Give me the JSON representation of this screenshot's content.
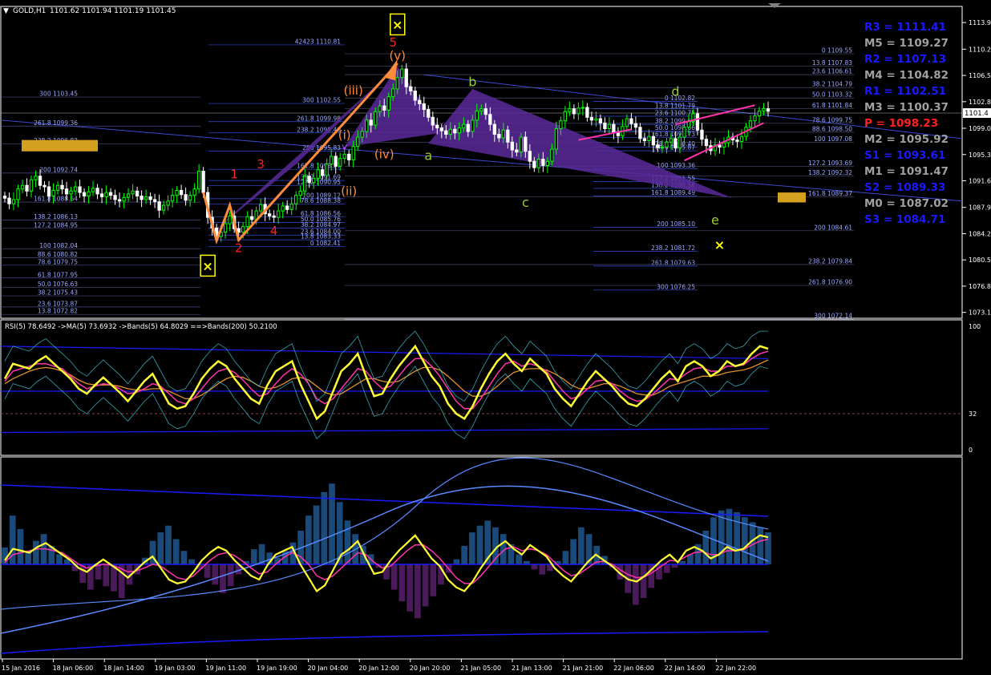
{
  "window": {
    "symbol_label": "GOLD,H1",
    "ohlc": "1101.62 1101.94 1101.19 1101.45",
    "current_price": "1101.45"
  },
  "colors": {
    "bg": "#000000",
    "grid": "#ffffff",
    "bull": "#00ff00",
    "bear": "#ffffff",
    "fib_blue": "#3a5bff",
    "pattern_purple": "#5a2a9a",
    "wave_orange": "#ff8c3a",
    "pivot_blue": "#1a1aff",
    "pivot_gray": "#a0a0a0",
    "pivot_red": "#ff2020",
    "rsi_yellow": "#ffff33",
    "magenta": "#ff33aa",
    "gold_box": "#d4a020"
  },
  "chart_data": [
    {
      "type": "candlestick",
      "panel": "main",
      "price_axis_ticks": [
        "1113.95",
        "1110.20",
        "1106.50",
        "1102.80",
        "1099.05",
        "1095.35",
        "1091.65",
        "1087.90",
        "1084.20",
        "1080.50",
        "1076.80",
        "1073.10"
      ],
      "ylim": [
        1072.5,
        1116.0
      ],
      "price_label": "1101.4",
      "time_labels": [
        "15 Jan 2016",
        "18 Jan 06:00",
        "18 Jan 14:00",
        "19 Jan 03:00",
        "19 Jan 11:00",
        "19 Jan 19:00",
        "20 Jan 04:00",
        "20 Jan 12:00",
        "20 Jan 20:00",
        "21 Jan 05:00",
        "21 Jan 13:00",
        "21 Jan 21:00",
        "22 Jan 06:00",
        "22 Jan 14:00",
        "22 Jan 22:00"
      ],
      "close": [
        1089.2,
        1088.4,
        1089.0,
        1090.5,
        1091.0,
        1090.2,
        1091.8,
        1092.3,
        1091.0,
        1090.8,
        1089.5,
        1090.3,
        1091.0,
        1090.5,
        1089.8,
        1090.2,
        1090.8,
        1090.0,
        1089.5,
        1090.1,
        1090.6,
        1089.8,
        1089.4,
        1090.0,
        1089.6,
        1089.0,
        1088.8,
        1089.3,
        1089.8,
        1090.2,
        1089.5,
        1089.0,
        1089.4,
        1089.0,
        1088.7,
        1087.5,
        1088.2,
        1088.8,
        1089.6,
        1090.3,
        1089.7,
        1088.9,
        1089.6,
        1090.5,
        1093.0,
        1090.0,
        1086.5,
        1085.0,
        1083.8,
        1084.4,
        1085.6,
        1086.7,
        1084.9,
        1084.4,
        1085.2,
        1086.6,
        1086.2,
        1087.4,
        1088.3,
        1087.0,
        1086.7,
        1086.5,
        1087.4,
        1088.1,
        1087.6,
        1088.4,
        1089.6,
        1090.2,
        1092.3,
        1091.4,
        1092.0,
        1093.2,
        1092.4,
        1094.0,
        1095.1,
        1093.7,
        1094.8,
        1095.4,
        1094.6,
        1096.5,
        1097.8,
        1098.6,
        1100.2,
        1099.5,
        1101.4,
        1102.2,
        1101.6,
        1103.5,
        1104.6,
        1106.2,
        1107.4,
        1104.9,
        1104.3,
        1103.0,
        1102.5,
        1101.7,
        1100.6,
        1099.5,
        1099.1,
        1098.7,
        1098.2,
        1098.9,
        1098.4,
        1099.1,
        1099.6,
        1098.6,
        1100.2,
        1101.5,
        1101.8,
        1101.0,
        1099.6,
        1098.2,
        1097.7,
        1098.8,
        1097.1,
        1096.0,
        1095.7,
        1097.8,
        1095.8,
        1094.4,
        1093.5,
        1094.7,
        1093.8,
        1094.4,
        1096.1,
        1099.0,
        1100.1,
        1101.4,
        1101.8,
        1101.1,
        1101.9,
        1102.0,
        1100.6,
        1100.2,
        1100.4,
        1099.8,
        1099.0,
        1099.6,
        1098.4,
        1098.0,
        1099.3,
        1100.4,
        1099.7,
        1099.2,
        1097.6,
        1097.3,
        1097.9,
        1096.7,
        1096.3,
        1096.4,
        1097.1,
        1097.6,
        1096.3,
        1097.8,
        1099.2,
        1100.0,
        1101.1,
        1098.8,
        1097.5,
        1096.6,
        1095.9,
        1096.7,
        1096.4,
        1097.0,
        1097.8,
        1097.4,
        1097.2,
        1097.9,
        1099.2,
        1100.1,
        1100.8,
        1101.5,
        1101.8,
        1101.45
      ],
      "fib_levels_left": [
        "300 1103.45",
        "261.8 1099.36",
        "238.2 1096.83",
        "200 1092.74",
        "161.8 1088.64",
        "138.2 1086.13",
        "127.2 1084.95",
        "100 1082.04",
        "88.6 1080.82",
        "78.6 1079.75",
        "61.8 1077.95",
        "50.0 1076.63",
        "38.2 1075.43",
        "23.6 1073.87",
        "13.8 1072.82"
      ],
      "fib_levels_mid1": [
        "42423 1110.81",
        "300 1102.55",
        "261.8 1099.98",
        "238.2 1098.40",
        "200 1095.83",
        "161.8 1093.27",
        "138.2 1091.69",
        "127.2 1090.95",
        "100 1089.12",
        "78.6 1088.38",
        "61.8 1086.56",
        "50.0 1085.76",
        "38.2 1084.97",
        "23.6 1084.00",
        "13.8 1083.33",
        "0 1082.41"
      ],
      "fib_levels_mid2": [
        "0 1102.82",
        "13.8 1101.79",
        "23.6 1100.75",
        "38.2 1099.60",
        "50.0 1098.66",
        "61.8 1097.73",
        "78.6 1096.40",
        "88.6 1095.87",
        "100 1093.36",
        "127.2 1091.55",
        "138.2 1090.58",
        "161.8 1089.49",
        "200 1085.10",
        "238.2 1081.72",
        "261.8 1079.63",
        "300 1076.25"
      ],
      "fib_levels_right": [
        "0 1109.55",
        "13.8 1107.83",
        "23.6 1106.61",
        "38.2 1104.79",
        "50.0 1103.32",
        "61.8 1101.84",
        "78.6 1099.75",
        "88.6 1098.50",
        "100 1097.08",
        "127.2 1093.69",
        "138.2 1092.32",
        "161.8 1089.37",
        "200 1084.61",
        "238.2 1079.84",
        "261.8 1076.90",
        "300 1072.14"
      ],
      "pivots": [
        {
          "label": "R3 = 1111.41",
          "kind": "blue"
        },
        {
          "label": "M5 = 1109.27",
          "kind": "gray"
        },
        {
          "label": "R2 = 1107.13",
          "kind": "blue"
        },
        {
          "label": "M4 = 1104.82",
          "kind": "gray"
        },
        {
          "label": "R1 = 1102.51",
          "kind": "blue"
        },
        {
          "label": "M3 = 1100.37",
          "kind": "gray"
        },
        {
          "label": "P   = 1098.23",
          "kind": "red"
        },
        {
          "label": "M2 = 1095.92",
          "kind": "gray"
        },
        {
          "label": "S1 = 1093.61",
          "kind": "blue"
        },
        {
          "label": "M1 = 1091.47",
          "kind": "gray"
        },
        {
          "label": "S2 = 1089.33",
          "kind": "blue"
        },
        {
          "label": "M0 = 1087.02",
          "kind": "gray"
        },
        {
          "label": "S3 = 1084.71",
          "kind": "blue"
        }
      ],
      "wave_labels": {
        "red": [
          "1",
          "2",
          "3",
          "4",
          "5"
        ],
        "orange": [
          "(i)",
          "(ii)",
          "(iii)",
          "(iv)",
          "(v)"
        ],
        "green": [
          "a",
          "b",
          "c",
          "d",
          "e"
        ]
      },
      "marker_symbol": "×"
    },
    {
      "type": "line",
      "panel": "rsi",
      "title": "RSI(5) 78.6492  ->MA(5) 73.6932  ->Bands(5) 64.8029  ==>Bands(200) 50.2100",
      "axis_ticks": [
        "100",
        "32",
        "0"
      ],
      "ylim": [
        0,
        100
      ],
      "series": [
        {
          "name": "RSI(5)",
          "values": [
            60,
            72,
            70,
            68,
            74,
            78,
            72,
            66,
            60,
            52,
            48,
            55,
            61,
            55,
            49,
            42,
            50,
            58,
            64,
            52,
            40,
            36,
            38,
            48,
            60,
            68,
            74,
            70,
            60,
            52,
            44,
            40,
            55,
            66,
            70,
            74,
            56,
            42,
            28,
            34,
            50,
            66,
            72,
            80,
            62,
            46,
            48,
            60,
            70,
            78,
            86,
            74,
            62,
            54,
            40,
            32,
            28,
            38,
            52,
            64,
            74,
            80,
            72,
            66,
            76,
            70,
            64,
            52,
            44,
            38,
            48,
            58,
            66,
            60,
            54,
            46,
            40,
            38,
            44,
            52,
            60,
            66,
            58,
            70,
            74,
            70,
            62,
            66,
            74,
            70,
            72,
            80,
            86,
            84
          ]
        },
        {
          "name": "MA(5)",
          "values": [
            58,
            66,
            68,
            70,
            72,
            72,
            70,
            68,
            62,
            56,
            52,
            54,
            56,
            55,
            52,
            48,
            49,
            52,
            56,
            54,
            48,
            42,
            40,
            44,
            52,
            60,
            66,
            68,
            65,
            59,
            52,
            46,
            48,
            56,
            63,
            68,
            64,
            56,
            44,
            40,
            44,
            52,
            60,
            68,
            66,
            58,
            52,
            54,
            62,
            70,
            76,
            76,
            70,
            62,
            52,
            42,
            36,
            36,
            44,
            54,
            64,
            72,
            74,
            70,
            72,
            70,
            66,
            58,
            50,
            44,
            46,
            52,
            58,
            59,
            56,
            50,
            45,
            42,
            43,
            48,
            54,
            60,
            59,
            64,
            68,
            69,
            66,
            66,
            70,
            70,
            71,
            76,
            80,
            82
          ]
        },
        {
          "name": "Bands(5)",
          "values": [
            56,
            60,
            63,
            66,
            68,
            69,
            68,
            66,
            63,
            59,
            56,
            55,
            55,
            55,
            54,
            52,
            51,
            51,
            52,
            52,
            50,
            47,
            44,
            44,
            47,
            51,
            56,
            60,
            62,
            61,
            58,
            54,
            52,
            53,
            56,
            60,
            61,
            59,
            54,
            49,
            47,
            48,
            52,
            56,
            60,
            60,
            58,
            57,
            58,
            62,
            66,
            69,
            69,
            67,
            62,
            56,
            50,
            46,
            46,
            49,
            54,
            60,
            65,
            67,
            68,
            68,
            67,
            64,
            60,
            55,
            52,
            52,
            54,
            56,
            56,
            54,
            51,
            48,
            47,
            47,
            50,
            54,
            56,
            58,
            60,
            62,
            62,
            63,
            65,
            66,
            67,
            69,
            72,
            75
          ]
        }
      ],
      "level_line": 32
    },
    {
      "type": "bar",
      "panel": "histogram",
      "values": [
        20,
        58,
        42,
        14,
        28,
        36,
        22,
        12,
        6,
        -8,
        -22,
        -30,
        -18,
        -26,
        -32,
        -40,
        -24,
        -12,
        8,
        28,
        38,
        46,
        30,
        16,
        6,
        -6,
        -16,
        -24,
        -34,
        -26,
        -12,
        4,
        18,
        24,
        14,
        8,
        16,
        26,
        40,
        58,
        70,
        86,
        96,
        74,
        52,
        36,
        22,
        12,
        -4,
        -18,
        -30,
        -44,
        -56,
        -64,
        -50,
        -38,
        -24,
        -10,
        6,
        22,
        38,
        46,
        52,
        44,
        36,
        24,
        12,
        4,
        -6,
        -12,
        -8,
        4,
        16,
        30,
        44,
        36,
        22,
        10,
        -4,
        -18,
        -34,
        -48,
        -40,
        -28,
        -18,
        -10,
        -4,
        4,
        12,
        24,
        40,
        56,
        64,
        66,
        62,
        56,
        50,
        44,
        38
      ]
    }
  ]
}
